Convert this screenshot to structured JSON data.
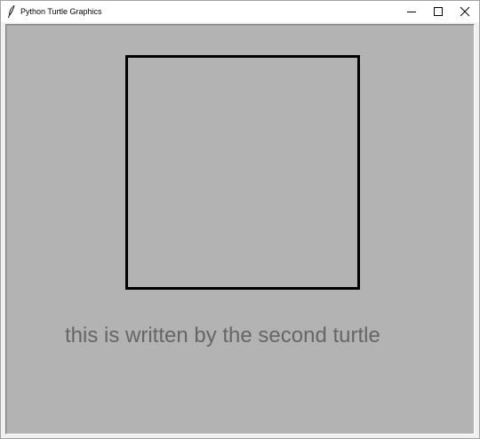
{
  "window": {
    "title": "Python Turtle Graphics",
    "app_icon": "feather-icon",
    "controls": [
      "minimize-icon",
      "maximize-icon",
      "close-icon"
    ]
  },
  "canvas": {
    "background": "#b3b3b3",
    "shapes": [
      {
        "type": "square",
        "stroke": "#000000"
      }
    ],
    "written_text": {
      "value": "this is written by the second turtle",
      "color": "#666666"
    }
  }
}
